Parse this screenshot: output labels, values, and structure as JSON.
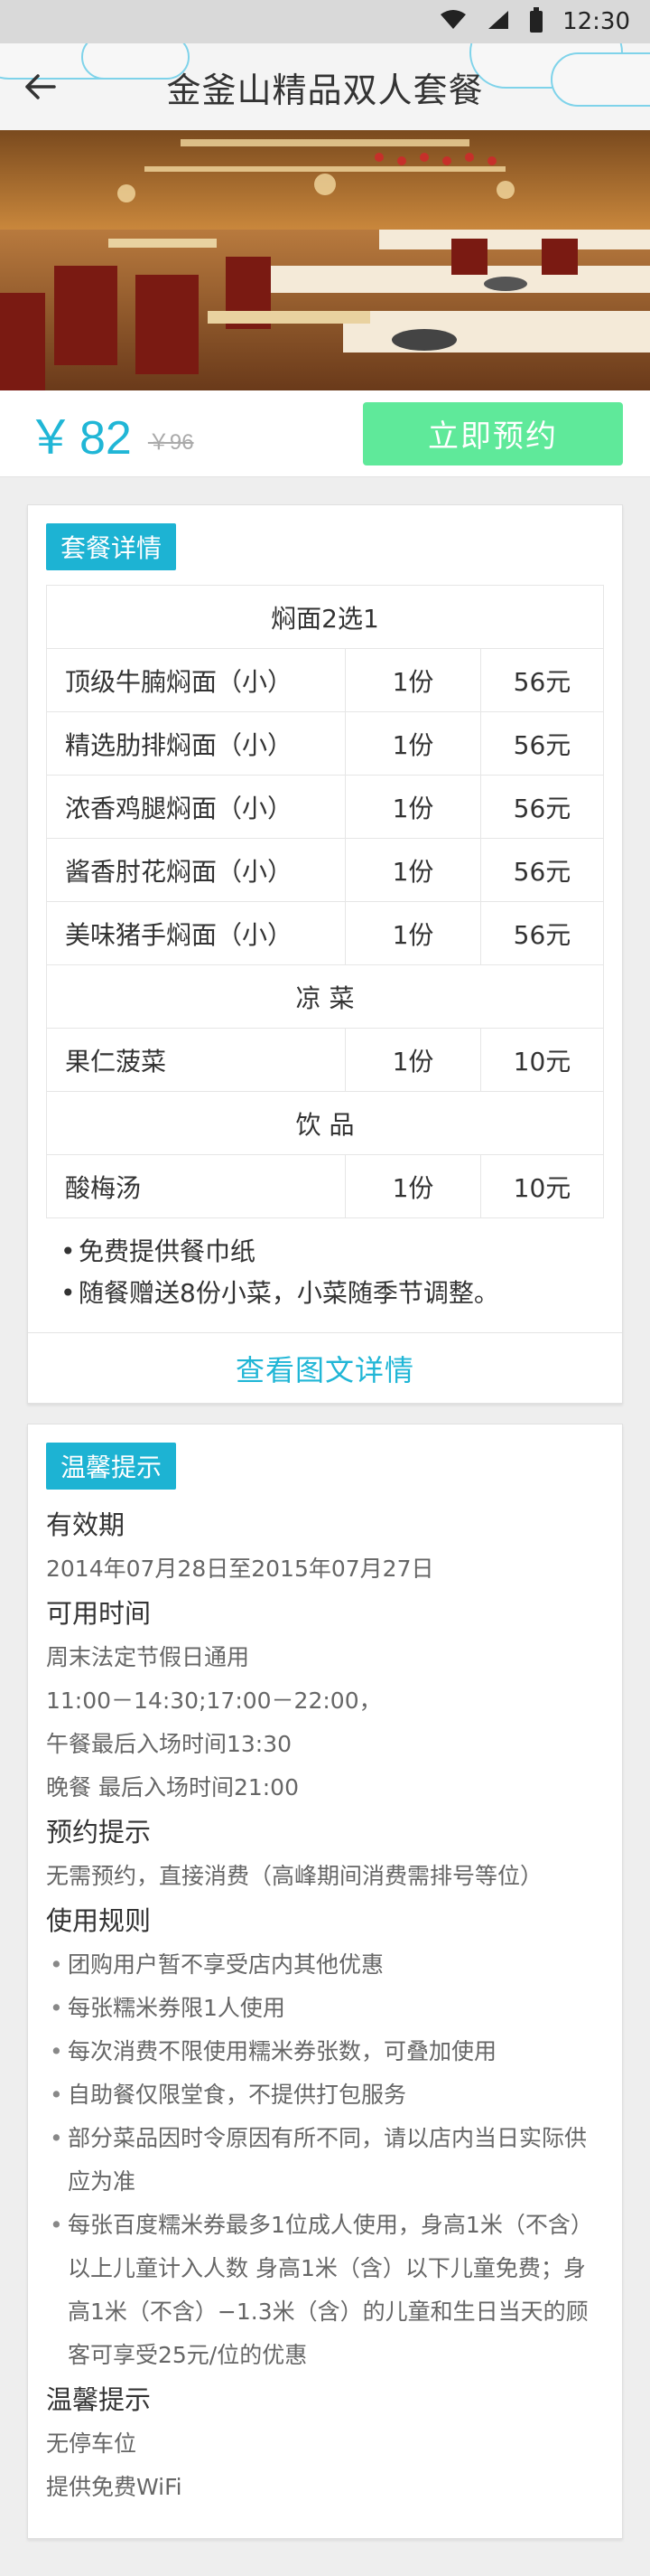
{
  "status_bar": {
    "time": "12:30",
    "icons": [
      "wifi-icon",
      "signal-icon",
      "battery-icon"
    ]
  },
  "header": {
    "title": "金釜山精品双人套餐",
    "back_icon": "arrow-left-icon"
  },
  "price": {
    "current": "82",
    "currency": "￥",
    "original": "￥96"
  },
  "book_button": {
    "label": "立即预约",
    "color": "#5fe99a"
  },
  "details": {
    "tag": "套餐详情",
    "sections": [
      {
        "title": "焖面2选1",
        "items": [
          {
            "name": "顶级牛腩焖面（小）",
            "qty": "1份",
            "price": "56元"
          },
          {
            "name": "精选肋排焖面（小）",
            "qty": "1份",
            "price": "56元"
          },
          {
            "name": "浓香鸡腿焖面（小）",
            "qty": "1份",
            "price": "56元"
          },
          {
            "name": "酱香肘花焖面（小）",
            "qty": "1份",
            "price": "56元"
          },
          {
            "name": "美味猪手焖面（小）",
            "qty": "1份",
            "price": "56元"
          }
        ]
      },
      {
        "title": "凉 菜",
        "items": [
          {
            "name": "果仁菠菜",
            "qty": "1份",
            "price": "10元"
          }
        ]
      },
      {
        "title": "饮 品",
        "items": [
          {
            "name": "酸梅汤",
            "qty": "1份",
            "price": "10元"
          }
        ]
      }
    ],
    "notes": [
      "免费提供餐巾纸",
      "随餐赠送8份小菜，小菜随季节调整。"
    ],
    "view_detail": "查看图文详情"
  },
  "tips": {
    "tag": "温馨提示",
    "validity_title": "有效期",
    "validity": "2014年07月28日至2015年07月27日",
    "hours_title": "可用时间",
    "hours": [
      "周末法定节假日通用",
      "11:00－14:30;17:00－22:00，",
      "午餐最后入场时间13:30",
      "晚餐 最后入场时间21:00"
    ],
    "booking_title": "预约提示",
    "booking": "无需预约，直接消费（高峰期间消费需排号等位）",
    "rules_title": "使用规则",
    "rules": [
      "团购用户暂不享受店内其他优惠",
      "每张糯米券限1人使用",
      "每次消费不限使用糯米券张数，可叠加使用",
      "自助餐仅限堂食，不提供打包服务",
      "部分菜品因时令原因有所不同，请以店内当日实际供应为准",
      "每张百度糯米券最多1位成人使用，身高1米（不含）以上儿童计入人数 身高1米（含）以下儿童免费；身高1米（不含）−1.3米（含）的儿童和生日当天的顾客可享受25元/位的优惠"
    ],
    "warm_title": "温馨提示",
    "warm": [
      "无停车位",
      "提供免费WiFi"
    ]
  },
  "colors": {
    "accent": "#1db3d3",
    "price": "#20b6d6",
    "book": "#5fe99a"
  }
}
